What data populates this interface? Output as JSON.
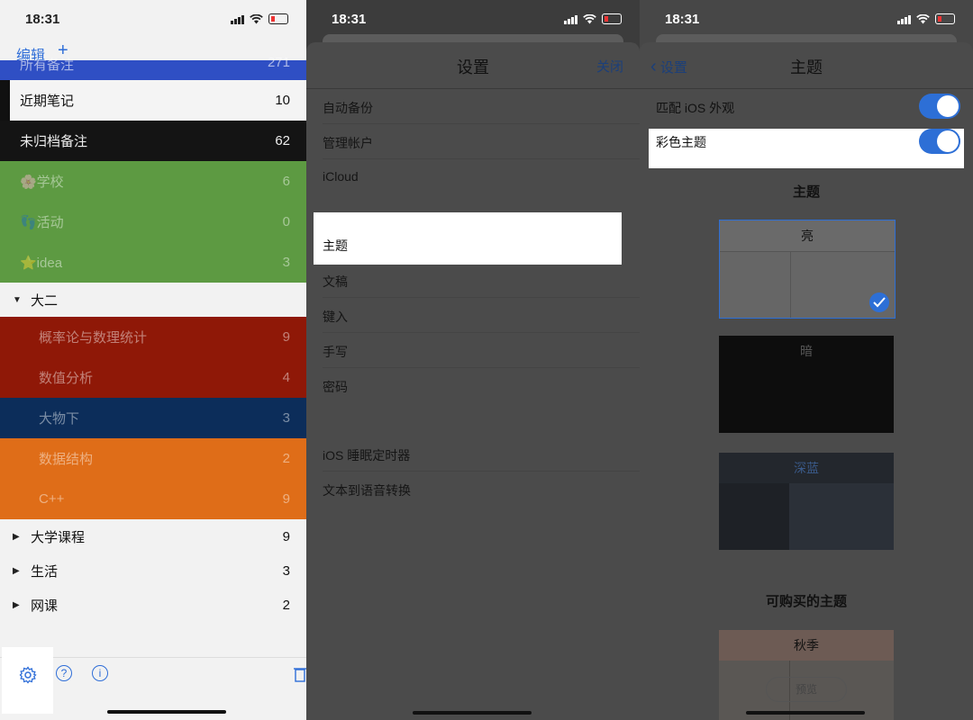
{
  "status": {
    "time": "18:31"
  },
  "notes_panel": {
    "toolbar": {
      "edit": "编辑",
      "add": "+"
    },
    "items": [
      {
        "label": "所有备注",
        "count": "271",
        "color": "#2f4fc4"
      },
      {
        "label": "近期笔记",
        "count": "10",
        "color": "#f4f4f4"
      },
      {
        "label": "未归档备注",
        "count": "62",
        "color": "#141414"
      },
      {
        "label": "🌸学校",
        "count": "6",
        "color": "#5d9a42"
      },
      {
        "label": "👣活动",
        "count": "0",
        "color": "#5d9a42"
      },
      {
        "label": "⭐idea",
        "count": "3",
        "color": "#5d9a42"
      },
      {
        "label": "大二",
        "count": "",
        "color": "#f2f2f2"
      },
      {
        "label": "概率论与数理统计",
        "count": "9",
        "color": "#8f1807"
      },
      {
        "label": "数值分析",
        "count": "4",
        "color": "#8f1807"
      },
      {
        "label": "大物下",
        "count": "3",
        "color": "#0c2d5a"
      },
      {
        "label": "数据结构",
        "count": "2",
        "color": "#df6d18"
      },
      {
        "label": "C++",
        "count": "9",
        "color": "#df6d18"
      },
      {
        "label": "大学课程",
        "count": "9",
        "color": "#f2f2f2"
      },
      {
        "label": "生活",
        "count": "3",
        "color": "#f2f2f2"
      },
      {
        "label": "网课",
        "count": "2",
        "color": "#f2f2f2"
      }
    ]
  },
  "settings_panel": {
    "title": "设置",
    "close": "关闭",
    "group1": [
      "自动备份",
      "管理帐户",
      "iCloud"
    ],
    "group2": [
      "主题",
      "文稿",
      "键入",
      "手写",
      "密码"
    ],
    "group3": [
      "iOS 睡眠定时器",
      "文本到语音转换"
    ]
  },
  "theme_panel": {
    "back": "设置",
    "title": "主题",
    "match_ios": "匹配 iOS 外观",
    "color_theme": "彩色主题",
    "themes_header": "主题",
    "themes": [
      "亮",
      "暗",
      "深蓝"
    ],
    "purchasable_header": "可购买的主题",
    "autumn": "秋季",
    "preview": "预览"
  }
}
